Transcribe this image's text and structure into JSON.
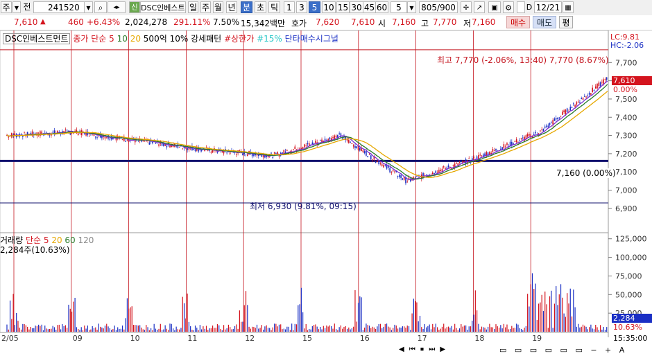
{
  "toolbar": {
    "market_type": "주",
    "market_dropdown": "▼",
    "code_prefix": "전",
    "stock_code": "241520",
    "stock_badge": "신",
    "stock_name": "DSC인베스트",
    "period_day": "일",
    "period_week": "주",
    "period_month": "월",
    "period_year": "년",
    "period_minute": "분",
    "period_second": "초",
    "period_tick": "틱",
    "interval_1": "1",
    "interval_3": "3",
    "interval_5": "5",
    "interval_10": "10",
    "interval_15": "15",
    "interval_30": "30",
    "interval_45": "45",
    "interval_60": "60",
    "interval_value": "5",
    "bar_count": "805/900",
    "d_label": "D",
    "date_value": "12/21"
  },
  "quote": {
    "price": "7,610",
    "change_arrow": "▲",
    "change": "460",
    "change_pct": "+6.43%",
    "volume": "2,024,278",
    "turnover_pct": "291.11%",
    "percent": "7.50%",
    "amount": "15,342백만",
    "bid_ask_label": "호가",
    "bid_ask_1": "7,620",
    "bid_ask_2": "7,610",
    "open_label": "시",
    "open": "7,160",
    "high_label": "고",
    "high": "7,770",
    "low_label": "저",
    "low": "7,160",
    "buy_label": "매수",
    "sell_label": "매도",
    "avg_label": "평"
  },
  "chart": {
    "legend_name": "DSC인베스트먼트",
    "legend_ma": "종가 단순 5",
    "legend_ma10": "10",
    "legend_ma20": "20",
    "legend_500": "500억",
    "legend_10pct": "10% 강세패턴",
    "legend_limitup": "#상한가",
    "legend_15pct": "#15%",
    "legend_signal": "단타매수시그널",
    "lc_label": "LC:9.81",
    "hc_label": "HC:-2.06",
    "high_annotation": "최고 7,770 (-2.06%, 13:40)",
    "high_annotation2": "7,770 (8.67%)",
    "low_annotation": "최저 6,930 (9.81%, 09:15)",
    "line_annotation": "7,160 (0.00%)",
    "current_price_tag": "7,610",
    "current_pct_tag": "0.00%",
    "vol_legend_name": "거래량",
    "vol_legend_ma": "단순 5",
    "vol_legend_20": "20",
    "vol_legend_60": "60",
    "vol_legend_120": "120",
    "vol_value": "2,284주(10.63%)",
    "vol_tag": "2,284",
    "vol_tag_pct": "10.63%",
    "time_now": "15:35:00",
    "colors": {
      "up": "#d4141e",
      "down": "#1a2fc4",
      "ma5": "#7a2fd0",
      "ma10": "#2a7a2a",
      "ma20": "#e6a800",
      "support": "#10106e"
    }
  },
  "chart_data": {
    "type": "line",
    "title": "",
    "price_axis": {
      "ticks": [
        "7,700",
        "7,600",
        "7,500",
        "7,400",
        "7,300",
        "7,200",
        "7,100",
        "7,000",
        "6,900"
      ],
      "ylim": [
        6850,
        7800
      ]
    },
    "volume_axis": {
      "ticks": [
        "125,000",
        "100,000",
        "75,000",
        "50,000",
        "25,000"
      ],
      "ylim": [
        0,
        135000
      ]
    },
    "x_tick_labels": [
      "2/05",
      "09",
      "10",
      "11",
      "12",
      "15",
      "16",
      "17",
      "18",
      "19"
    ],
    "reference_lines": {
      "high": 7770,
      "support": 7160,
      "low": 6930
    },
    "series": [
      {
        "name": "종가",
        "x": [
          "2/05",
          "09",
          "10",
          "11",
          "12",
          "15",
          "16",
          "17",
          "18",
          "19"
        ],
        "values": [
          7300,
          7320,
          7270,
          7220,
          7190,
          7300,
          7050,
          7170,
          7320,
          7610
        ]
      }
    ]
  }
}
